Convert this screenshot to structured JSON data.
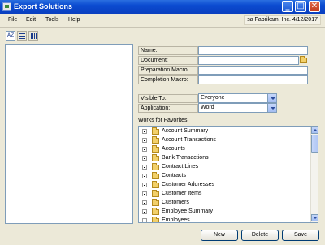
{
  "window": {
    "title": "Export Solutions",
    "minimize_label": "_",
    "maximize_label": "□",
    "close_label": "✕"
  },
  "menu": [
    "File",
    "Edit",
    "Tools",
    "Help"
  ],
  "session": "sa  Fabrikam, Inc.  4/12/2017",
  "toolbar": [
    {
      "name": "sort-alpha-icon",
      "glyph": "AZ"
    },
    {
      "name": "list-view-icon"
    },
    {
      "name": "columns-view-icon"
    }
  ],
  "form": {
    "name_label": "Name:",
    "document_label": "Document:",
    "prep_macro_label": "Preparation Macro:",
    "completion_macro_label": "Completion Macro:",
    "visible_to_label": "Visible To:",
    "visible_to_value": "Everyone",
    "application_label": "Application:",
    "application_value": "Word",
    "favorites_label": "Works for Favorites:"
  },
  "favorites": [
    "Account Summary",
    "Account Transactions",
    "Accounts",
    "Bank Transactions",
    "Contract Lines",
    "Contracts",
    "Customer Addresses",
    "Customer Items",
    "Customers",
    "Employee Summary",
    "Employees"
  ],
  "buttons": {
    "new": "New",
    "delete": "Delete",
    "save": "Save"
  },
  "colors": {
    "titlebar": "#0b4bd0",
    "dialog": "#ece9d8",
    "folder": "#f2d06a"
  }
}
